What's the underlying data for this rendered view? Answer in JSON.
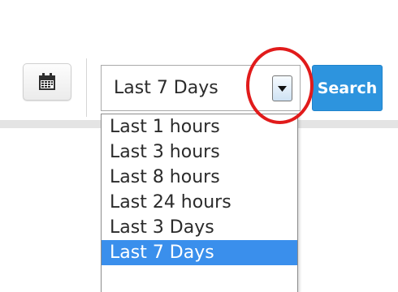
{
  "icons": {
    "calendar": "calendar-icon",
    "dropdown_arrow": "caret-down-icon"
  },
  "colors": {
    "accent_blue": "#2d94de",
    "selected_option": "#3a8fec",
    "annotation_red": "#e11b1b"
  },
  "date_range": {
    "selected_label": "Last 7 Days",
    "options": [
      "Last 1 hours",
      "Last 3 hours",
      "Last 8 hours",
      "Last 24 hours",
      "Last 3 Days",
      "Last 7 Days"
    ],
    "selected_index": 5
  },
  "toolbar": {
    "search_label": "Search"
  }
}
